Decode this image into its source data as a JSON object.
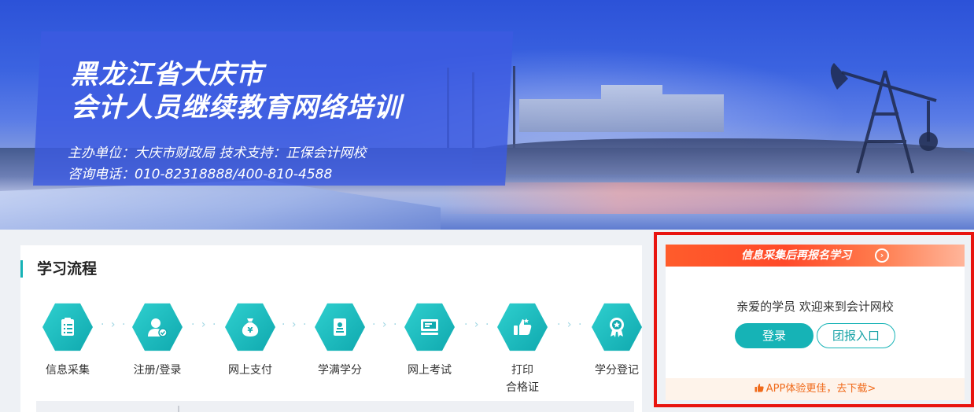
{
  "banner": {
    "title_line1": "黑龙江省大庆市",
    "title_line2": "会计人员继续教育网络培训",
    "organizer": "主办单位：大庆市财政局    技术支持：正保会计网校",
    "hotline": "咨询电话：010-82318888/400-810-4588"
  },
  "process": {
    "title": "学习流程",
    "accent_color": "#16b3b6",
    "steps": [
      {
        "label": "信息采集",
        "icon": "clipboard-icon"
      },
      {
        "label": "注册/登录",
        "icon": "user-check-icon"
      },
      {
        "label": "网上支付",
        "icon": "money-bag-icon"
      },
      {
        "label": "学满学分",
        "icon": "certificate-icon"
      },
      {
        "label": "网上考试",
        "icon": "computer-icon"
      },
      {
        "label": "打印",
        "label2": "合格证",
        "icon": "thumbs-up-icon"
      },
      {
        "label": "学分登记",
        "icon": "medal-icon"
      }
    ],
    "arrow_text": "· › ·"
  },
  "login": {
    "promo_text": "信息采集后再报名学习",
    "promo_arrow": "›",
    "welcome": "亲爱的学员 欢迎来到会计网校",
    "login_button": "登录",
    "group_button": "团报入口",
    "app_text": "APP体验更佳，去下载>",
    "highlight_color": "#e8140f",
    "app_color": "#f06a1a"
  }
}
